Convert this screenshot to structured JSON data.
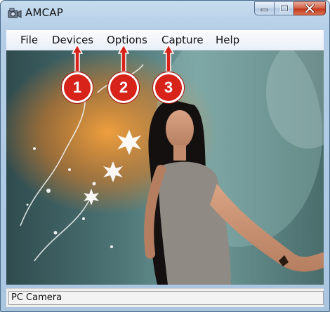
{
  "window": {
    "title": "AMCAP",
    "icon": "camera-app-icon"
  },
  "caption_buttons": {
    "minimize": "minimize-icon",
    "maximize": "maximize-icon",
    "close": "close-icon"
  },
  "menu": {
    "items": [
      "File",
      "Devices",
      "Options",
      "Capture",
      "Help"
    ]
  },
  "annotations": {
    "markers": [
      "1",
      "2",
      "3"
    ],
    "color": "#d8231a"
  },
  "video": {
    "content": "camera preview image"
  },
  "status": {
    "text": "PC Camera"
  }
}
